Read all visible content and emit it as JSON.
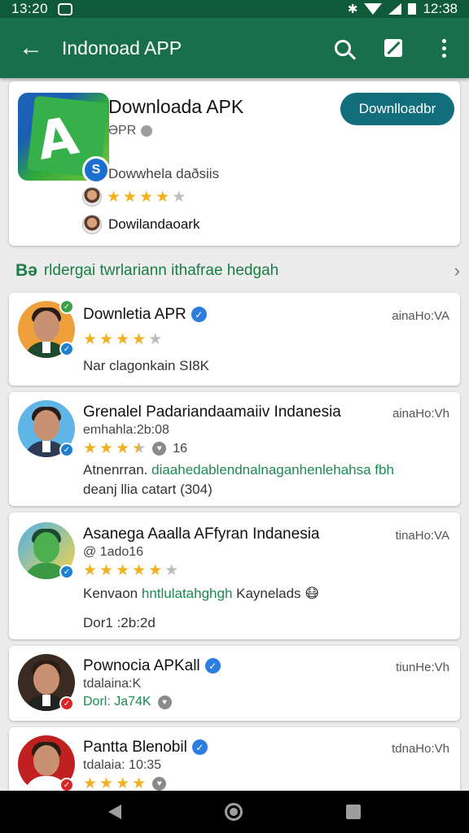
{
  "statusbar": {
    "time": "13:20",
    "time_right": "12:38"
  },
  "appbar": {
    "title": "Indonoad APP"
  },
  "hero": {
    "app_name": "Downloada APK",
    "sub": "ƏPR",
    "desc": "Dowwhela daðsiis",
    "rating": 4,
    "dev_name": "Dowilandaoark",
    "download_label": "Downlloadbr"
  },
  "section": {
    "prefix": "Bə",
    "title": "rldergai twrlariann ithafrae hedgah"
  },
  "reviews": [
    {
      "name": "Downletia APR",
      "meta": "ainaHo:VA",
      "stars": 4,
      "star_half": true,
      "line1": "Nar clagonkain SI8K",
      "accent": "#1f80d0"
    },
    {
      "name": "Grenalel Padariandaamaiiv Indanesia",
      "meta": "ainaHo:Vh",
      "sub": "emhahla:2b:08",
      "stars": 3,
      "star_half": true,
      "count": "16",
      "line1_a": "Atnenrran.",
      "line1_b": "diaahedablendnalnaganhenlehahsa fbh",
      "line2": "deanj llia catart (304)",
      "accent": "#1f80d0"
    },
    {
      "name": "Asanega Aaalla AFfyran Indanesia",
      "meta": "tinaHo:VA",
      "sub": "@ 1ado16",
      "stars": 5,
      "star_half": false,
      "line1_a": "Kenvaon",
      "line1_b": "hntlulatahghgh",
      "line1_c": "Kaynelads",
      "line2": "Dor1 :2b:2d",
      "accent": "#1f80d0"
    },
    {
      "name": "Pownocia APKall",
      "meta": "tiunHe:Vh",
      "sub": "tdalaina:K",
      "line1": "Dorl: Ja74K",
      "accent": "#d62828"
    },
    {
      "name": "Pantta Blenobil",
      "meta": "tdnaHo:Vh",
      "sub": "tdalaia: 10:35",
      "stars": 4,
      "star_half": false,
      "accent": "#d62828"
    }
  ]
}
